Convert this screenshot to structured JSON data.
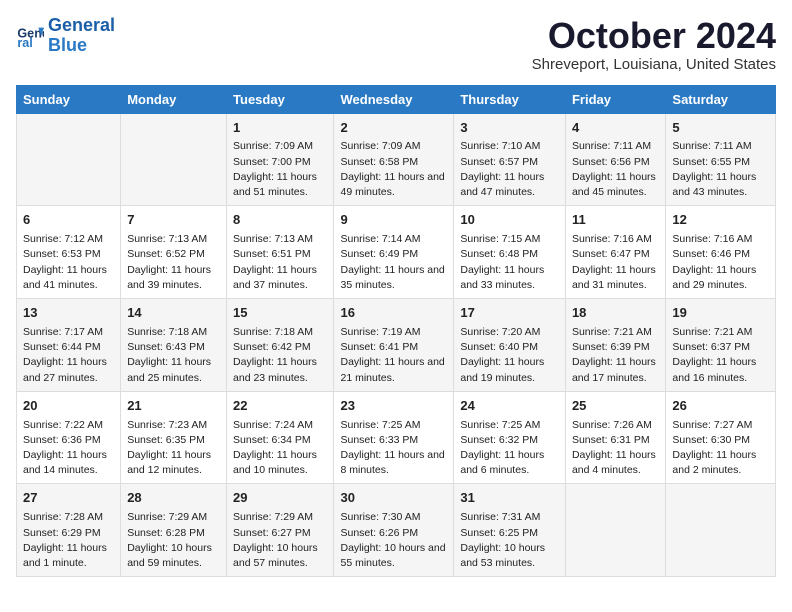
{
  "header": {
    "logo_line1": "General",
    "logo_line2": "Blue",
    "month_title": "October 2024",
    "location": "Shreveport, Louisiana, United States"
  },
  "days_of_week": [
    "Sunday",
    "Monday",
    "Tuesday",
    "Wednesday",
    "Thursday",
    "Friday",
    "Saturday"
  ],
  "weeks": [
    [
      {
        "day": "",
        "content": ""
      },
      {
        "day": "",
        "content": ""
      },
      {
        "day": "1",
        "content": "Sunrise: 7:09 AM\nSunset: 7:00 PM\nDaylight: 11 hours and 51 minutes."
      },
      {
        "day": "2",
        "content": "Sunrise: 7:09 AM\nSunset: 6:58 PM\nDaylight: 11 hours and 49 minutes."
      },
      {
        "day": "3",
        "content": "Sunrise: 7:10 AM\nSunset: 6:57 PM\nDaylight: 11 hours and 47 minutes."
      },
      {
        "day": "4",
        "content": "Sunrise: 7:11 AM\nSunset: 6:56 PM\nDaylight: 11 hours and 45 minutes."
      },
      {
        "day": "5",
        "content": "Sunrise: 7:11 AM\nSunset: 6:55 PM\nDaylight: 11 hours and 43 minutes."
      }
    ],
    [
      {
        "day": "6",
        "content": "Sunrise: 7:12 AM\nSunset: 6:53 PM\nDaylight: 11 hours and 41 minutes."
      },
      {
        "day": "7",
        "content": "Sunrise: 7:13 AM\nSunset: 6:52 PM\nDaylight: 11 hours and 39 minutes."
      },
      {
        "day": "8",
        "content": "Sunrise: 7:13 AM\nSunset: 6:51 PM\nDaylight: 11 hours and 37 minutes."
      },
      {
        "day": "9",
        "content": "Sunrise: 7:14 AM\nSunset: 6:49 PM\nDaylight: 11 hours and 35 minutes."
      },
      {
        "day": "10",
        "content": "Sunrise: 7:15 AM\nSunset: 6:48 PM\nDaylight: 11 hours and 33 minutes."
      },
      {
        "day": "11",
        "content": "Sunrise: 7:16 AM\nSunset: 6:47 PM\nDaylight: 11 hours and 31 minutes."
      },
      {
        "day": "12",
        "content": "Sunrise: 7:16 AM\nSunset: 6:46 PM\nDaylight: 11 hours and 29 minutes."
      }
    ],
    [
      {
        "day": "13",
        "content": "Sunrise: 7:17 AM\nSunset: 6:44 PM\nDaylight: 11 hours and 27 minutes."
      },
      {
        "day": "14",
        "content": "Sunrise: 7:18 AM\nSunset: 6:43 PM\nDaylight: 11 hours and 25 minutes."
      },
      {
        "day": "15",
        "content": "Sunrise: 7:18 AM\nSunset: 6:42 PM\nDaylight: 11 hours and 23 minutes."
      },
      {
        "day": "16",
        "content": "Sunrise: 7:19 AM\nSunset: 6:41 PM\nDaylight: 11 hours and 21 minutes."
      },
      {
        "day": "17",
        "content": "Sunrise: 7:20 AM\nSunset: 6:40 PM\nDaylight: 11 hours and 19 minutes."
      },
      {
        "day": "18",
        "content": "Sunrise: 7:21 AM\nSunset: 6:39 PM\nDaylight: 11 hours and 17 minutes."
      },
      {
        "day": "19",
        "content": "Sunrise: 7:21 AM\nSunset: 6:37 PM\nDaylight: 11 hours and 16 minutes."
      }
    ],
    [
      {
        "day": "20",
        "content": "Sunrise: 7:22 AM\nSunset: 6:36 PM\nDaylight: 11 hours and 14 minutes."
      },
      {
        "day": "21",
        "content": "Sunrise: 7:23 AM\nSunset: 6:35 PM\nDaylight: 11 hours and 12 minutes."
      },
      {
        "day": "22",
        "content": "Sunrise: 7:24 AM\nSunset: 6:34 PM\nDaylight: 11 hours and 10 minutes."
      },
      {
        "day": "23",
        "content": "Sunrise: 7:25 AM\nSunset: 6:33 PM\nDaylight: 11 hours and 8 minutes."
      },
      {
        "day": "24",
        "content": "Sunrise: 7:25 AM\nSunset: 6:32 PM\nDaylight: 11 hours and 6 minutes."
      },
      {
        "day": "25",
        "content": "Sunrise: 7:26 AM\nSunset: 6:31 PM\nDaylight: 11 hours and 4 minutes."
      },
      {
        "day": "26",
        "content": "Sunrise: 7:27 AM\nSunset: 6:30 PM\nDaylight: 11 hours and 2 minutes."
      }
    ],
    [
      {
        "day": "27",
        "content": "Sunrise: 7:28 AM\nSunset: 6:29 PM\nDaylight: 11 hours and 1 minute."
      },
      {
        "day": "28",
        "content": "Sunrise: 7:29 AM\nSunset: 6:28 PM\nDaylight: 10 hours and 59 minutes."
      },
      {
        "day": "29",
        "content": "Sunrise: 7:29 AM\nSunset: 6:27 PM\nDaylight: 10 hours and 57 minutes."
      },
      {
        "day": "30",
        "content": "Sunrise: 7:30 AM\nSunset: 6:26 PM\nDaylight: 10 hours and 55 minutes."
      },
      {
        "day": "31",
        "content": "Sunrise: 7:31 AM\nSunset: 6:25 PM\nDaylight: 10 hours and 53 minutes."
      },
      {
        "day": "",
        "content": ""
      },
      {
        "day": "",
        "content": ""
      }
    ]
  ]
}
